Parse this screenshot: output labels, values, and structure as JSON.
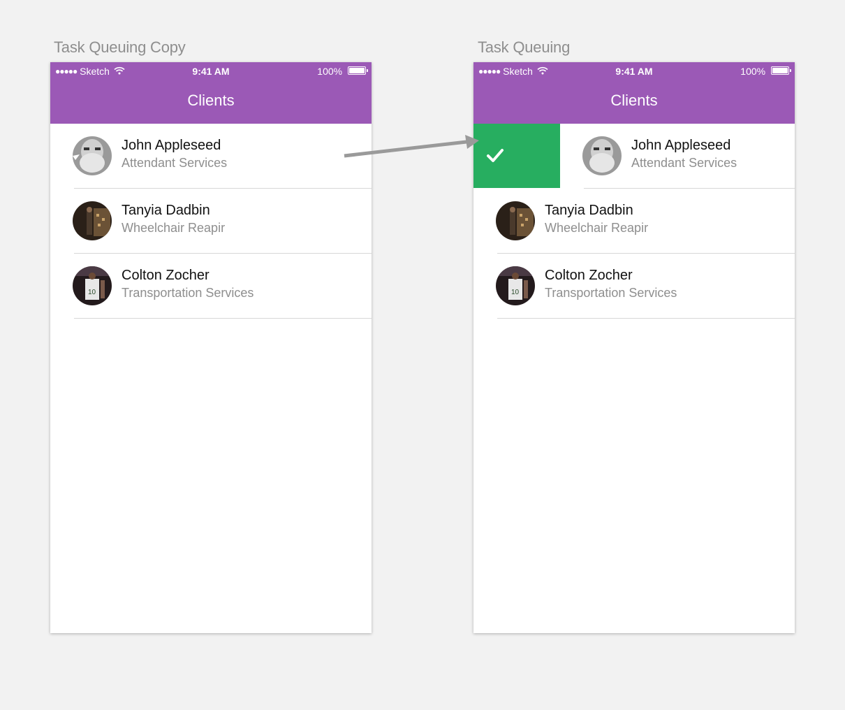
{
  "artboards": [
    {
      "label": "Task Queuing Copy",
      "status": {
        "carrier": "Sketch",
        "dots": "●●●●●",
        "time": "9:41 AM",
        "battery": "100%"
      },
      "nav_title": "Clients",
      "rows": [
        {
          "name": "John Appleseed",
          "service": "Attendant Services"
        },
        {
          "name": "Tanyia Dadbin",
          "service": "Wheelchair Reapir"
        },
        {
          "name": "Colton Zocher",
          "service": "Transportation Services"
        }
      ]
    },
    {
      "label": "Task Queuing",
      "status": {
        "carrier": "Sketch",
        "dots": "●●●●●",
        "time": "9:41 AM",
        "battery": "100%"
      },
      "nav_title": "Clients",
      "rows": [
        {
          "name": "John Appleseed",
          "service": "Attendant Services"
        },
        {
          "name": "Tanyia Dadbin",
          "service": "Wheelchair Reapir"
        },
        {
          "name": "Colton Zocher",
          "service": "Transportation Services"
        }
      ],
      "swipe_action_icon": "checkmark-icon"
    }
  ],
  "colors": {
    "nav_bar": "#9b59b6",
    "swipe_action": "#27ae60",
    "canvas": "#f2f2f2"
  },
  "icons": {
    "wifi": "wifi-icon",
    "battery": "battery-icon",
    "arrow": "flow-arrow-icon"
  }
}
